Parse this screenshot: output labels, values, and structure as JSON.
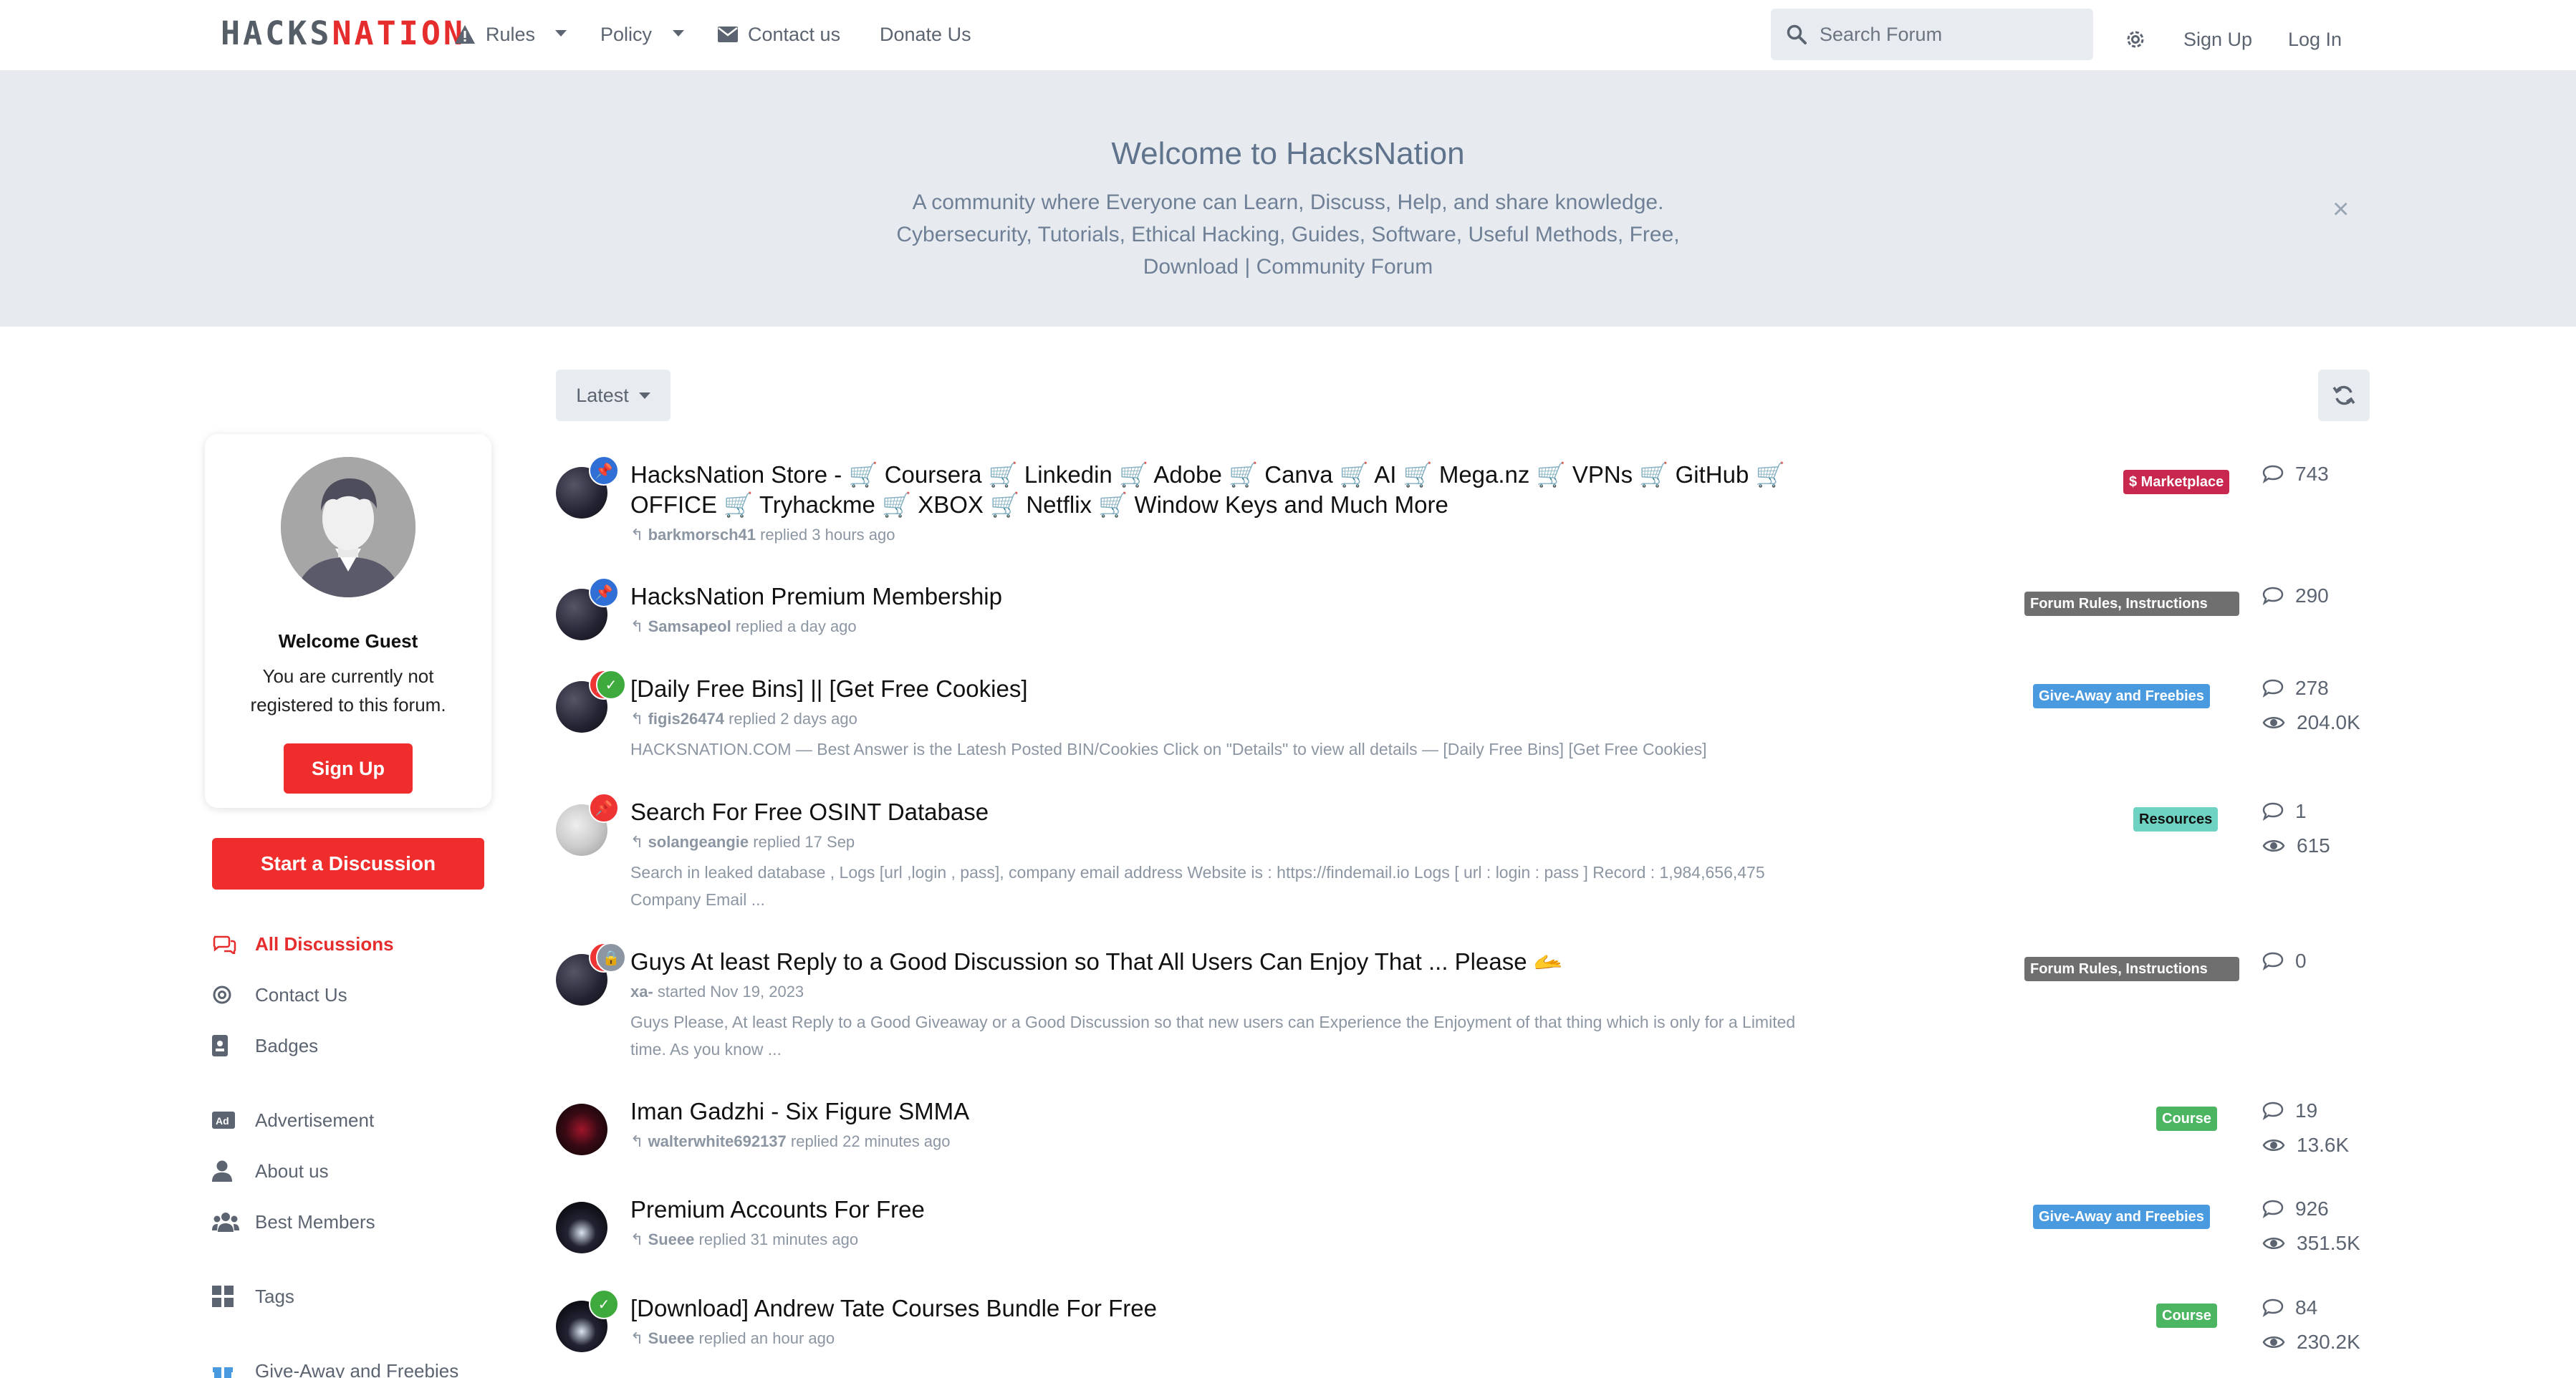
{
  "header": {
    "logo_part1": "HACKS",
    "logo_part2": "NATION",
    "nav": {
      "rules": "Rules",
      "policy": "Policy",
      "contact": "Contact us",
      "donate": "Donate Us"
    },
    "search_placeholder": "Search Forum",
    "sign_up": "Sign Up",
    "log_in": "Log In"
  },
  "hero": {
    "title": "Welcome to HacksNation",
    "description": "A community where Everyone can Learn, Discuss, Help, and share knowledge. Cybersecurity, Tutorials, Ethical Hacking, Guides, Software, Useful Methods, Free, Download | Community Forum",
    "close_glyph": "×"
  },
  "sidebar": {
    "guest_title": "Welcome Guest",
    "guest_text": "You are currently not registered to this forum.",
    "guest_signup": "Sign Up",
    "start_discussion": "Start a Discussion",
    "items": [
      {
        "label": "All Discussions",
        "icon": "comments-icon"
      },
      {
        "label": "Contact Us",
        "icon": "at-icon"
      },
      {
        "label": "Badges",
        "icon": "id-badge-icon"
      },
      {
        "label": "Advertisement",
        "icon": "ad-icon"
      },
      {
        "label": "About us",
        "icon": "user-icon"
      },
      {
        "label": "Best Members",
        "icon": "users-icon"
      },
      {
        "label": "Tags",
        "icon": "grid-icon"
      },
      {
        "label": "Give-Away and Freebies",
        "icon": "gift-icon"
      }
    ]
  },
  "toolbar": {
    "sort_label": "Latest"
  },
  "discussions": [
    {
      "title": "HacksNation Store - 🛒 Coursera 🛒 Linkedin 🛒 Adobe 🛒 Canva 🛒 AI 🛒 Mega.nz 🛒 VPNs 🛒 GitHub 🛒 OFFICE 🛒 Tryhackme 🛒 XBOX 🛒 Netflix 🛒 Window Keys and Much More",
      "user": "barkmorsch41",
      "action": "replied 3 hours ago",
      "tag": "$ Marketplace",
      "tag_color": "#c9284e",
      "replies": "743",
      "views": ""
    },
    {
      "title": "HacksNation Premium Membership",
      "user": "Samsapeol",
      "action": "replied a day ago",
      "tag": "Forum Rules, Instructions",
      "tag_color": "#6f6f6f",
      "replies": "290",
      "views": ""
    },
    {
      "title": "[Daily Free Bins] || [Get Free Cookies]",
      "user": "figis26474",
      "action": "replied 2 days ago",
      "excerpt": "HACKSNATION.COM — Best Answer is the Latesh Posted BIN/Cookies Click on \"Details\" to view all details — [Daily Free Bins] [Get Free Cookies]",
      "tag": "Give-Away and Freebies",
      "tag_color": "#4a9ae0",
      "replies": "278",
      "views": "204.0K"
    },
    {
      "title": "Search For Free OSINT Database",
      "user": "solangeangie",
      "action": "replied 17 Sep",
      "excerpt": "Search in leaked database , Logs [url ,login , pass], company email address Website is : https://findemail.io Logs [ url : login : pass ] Record : 1,984,656,475 Company Email ...",
      "tag": "Resources",
      "tag_color": "#6ed3c2",
      "replies": "1",
      "views": "615"
    },
    {
      "title": "Guys At least Reply to a Good Discussion so That All Users Can Enjoy That ... Please 🫴",
      "user": "xa-",
      "action": "started Nov 19, 2023",
      "excerpt": "Guys Please, At least Reply to a Good Giveaway or a Good Discussion so that new users can Experience the Enjoyment of that thing which is only for a Limited time. As you know ...",
      "tag": "Forum Rules, Instructions",
      "tag_color": "#6f6f6f",
      "replies": "0",
      "views": ""
    },
    {
      "title": "Iman Gadzhi - Six Figure SMMA",
      "user": "walterwhite692137",
      "action": "replied 22 minutes ago",
      "tag": "Course",
      "tag_color": "#4cb562",
      "replies": "19",
      "views": "13.6K"
    },
    {
      "title": "Premium Accounts For Free",
      "user": "Sueee",
      "action": "replied 31 minutes ago",
      "tag": "Give-Away and Freebies",
      "tag_color": "#4a9ae0",
      "replies": "926",
      "views": "351.5K"
    },
    {
      "title": "[Download] Andrew Tate Courses Bundle For Free",
      "user": "Sueee",
      "action": "replied an hour ago",
      "tag": "Course",
      "tag_color": "#4cb562",
      "replies": "84",
      "views": "230.2K"
    }
  ],
  "colors": {
    "accent": "#ef2d2d",
    "muted": "#5b6470",
    "hero_bg": "#e7ebf0"
  }
}
